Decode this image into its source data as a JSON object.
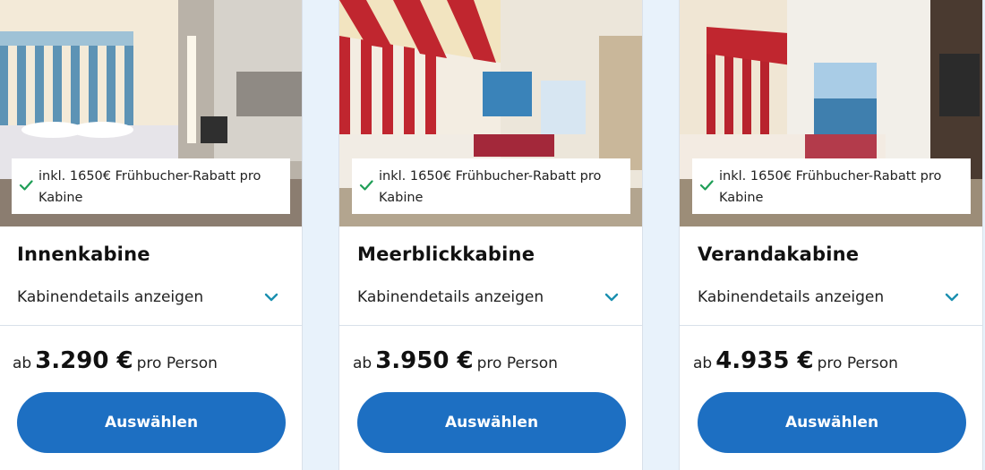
{
  "cabins": [
    {
      "name": "Innenkabine",
      "badge_text": "inkl. 1650€ Frühbucher-Rabatt pro Kabine",
      "details_label": "Kabinendetails anzeigen",
      "price_prefix": "ab",
      "price": "3.290 €",
      "price_suffix": "pro Person",
      "button_label": "Auswählen"
    },
    {
      "name": "Meerblickkabine",
      "badge_text": "inkl. 1650€ Frühbucher-Rabatt pro Kabine",
      "details_label": "Kabinendetails anzeigen",
      "price_prefix": "ab",
      "price": "3.950 €",
      "price_suffix": "pro Person",
      "button_label": "Auswählen"
    },
    {
      "name": "Verandakabine",
      "badge_text": "inkl. 1650€ Frühbucher-Rabatt pro Kabine",
      "details_label": "Kabinendetails anzeigen",
      "price_prefix": "ab",
      "price": "4.935 €",
      "price_suffix": "pro Person",
      "button_label": "Auswählen"
    }
  ],
  "colors": {
    "accent_button": "#1d6fc2",
    "check_green": "#1f9e57",
    "chevron_teal": "#1a8fb0",
    "page_background": "#e8f2fb"
  }
}
